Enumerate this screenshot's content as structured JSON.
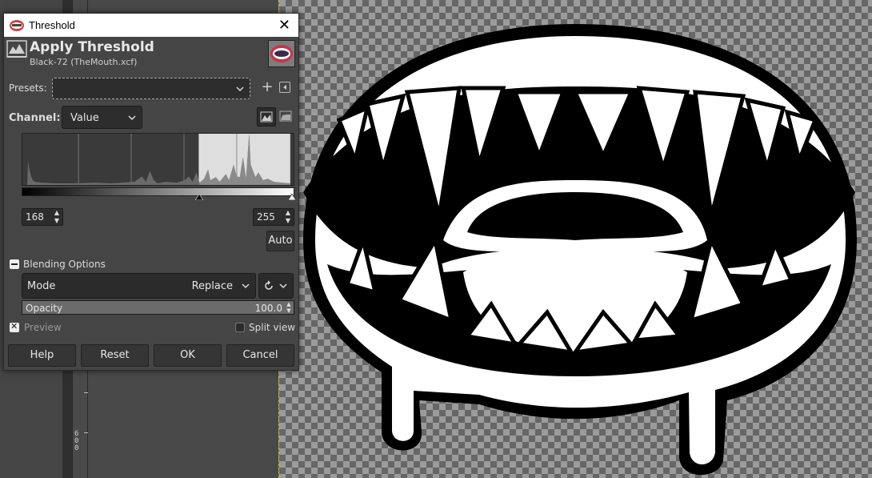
{
  "window": {
    "title": "Threshold",
    "close_glyph": "✕"
  },
  "header": {
    "title": "Apply Threshold",
    "subtitle": "Black-72 (TheMouth.xcf)"
  },
  "presets": {
    "label": "Presets:",
    "value": "",
    "add_glyph": "+"
  },
  "channel": {
    "label": "Channel:",
    "value": "Value"
  },
  "threshold": {
    "low": "168",
    "high": "255",
    "histogram_range_max": 255
  },
  "auto_label": "Auto",
  "blending": {
    "section_label": "Blending Options",
    "mode_label": "Mode",
    "mode_value": "Replace",
    "opacity_label": "Opacity",
    "opacity_value": "100.0"
  },
  "preview": {
    "label": "Preview",
    "checked": true
  },
  "split_view": {
    "label": "Split view",
    "checked": false
  },
  "buttons": {
    "help": "Help",
    "reset": "Reset",
    "ok": "OK",
    "cancel": "Cancel"
  },
  "ruler": {
    "label": "600"
  },
  "colors": {
    "dialog_bg": "#454545",
    "field_bg": "#2d2d2d",
    "histogram_selected": "#dedede",
    "canvas_checker_dark": "#666666",
    "canvas_checker_light": "#9b9b9b"
  }
}
